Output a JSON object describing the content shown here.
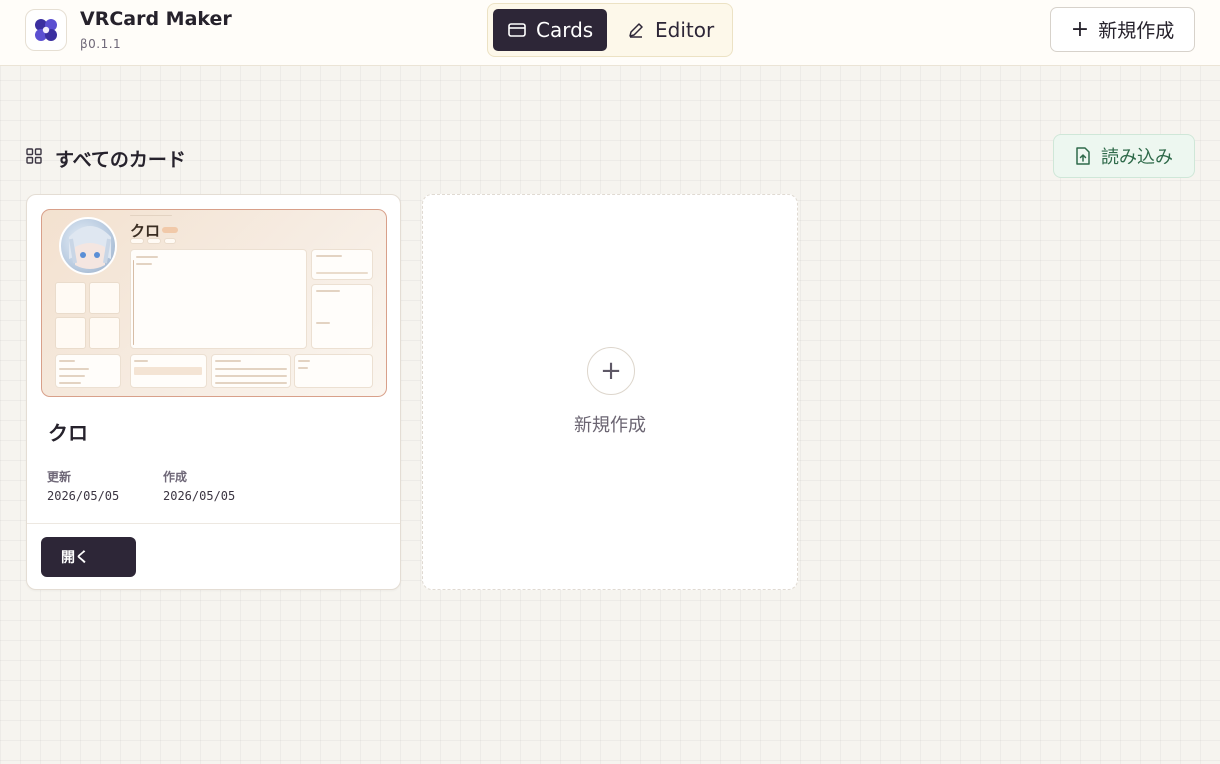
{
  "app": {
    "title": "VRCard Maker",
    "version": "β0.1.1"
  },
  "nav": {
    "tabs": [
      {
        "label": "Cards",
        "icon": "card-icon",
        "active": true
      },
      {
        "label": "Editor",
        "icon": "pencil-icon",
        "active": false
      }
    ],
    "new_label": "新規作成"
  },
  "section": {
    "title": "すべてのカード",
    "import_label": "読み込み"
  },
  "cards": [
    {
      "name": "クロ",
      "updated_label": "更新",
      "updated": "2026/05/05",
      "created_label": "作成",
      "created": "2026/05/05",
      "open_label": "開く",
      "thumbnail_name": "クロ"
    }
  ],
  "new_card": {
    "label": "新規作成"
  },
  "colors": {
    "accent_dark": "#2d2637",
    "import_green": "#2f6a4a",
    "thumb_border": "#d8a08a"
  }
}
